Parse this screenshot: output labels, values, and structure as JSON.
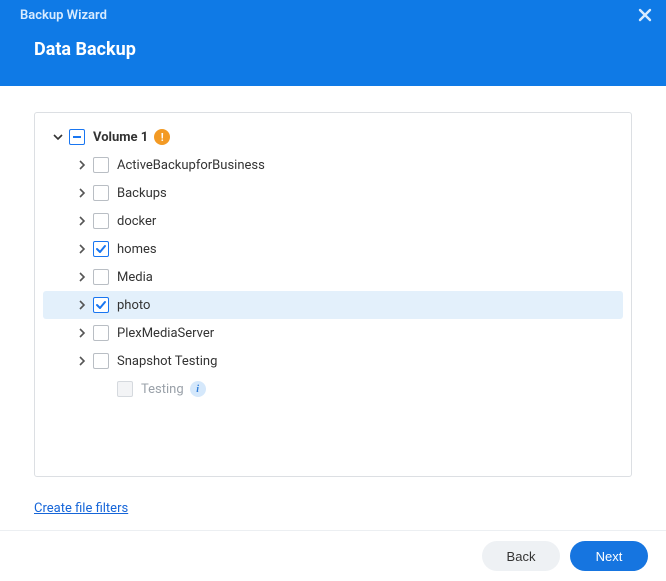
{
  "header": {
    "wizard_title": "Backup Wizard",
    "page_title": "Data Backup"
  },
  "tree": {
    "root": {
      "label": "Volume 1",
      "warn_badge": "!",
      "items": [
        {
          "label": "ActiveBackupforBusiness",
          "state": "unchecked",
          "expandable": true
        },
        {
          "label": "Backups",
          "state": "unchecked",
          "expandable": true
        },
        {
          "label": "docker",
          "state": "unchecked",
          "expandable": true
        },
        {
          "label": "homes",
          "state": "checked",
          "expandable": true
        },
        {
          "label": "Media",
          "state": "unchecked",
          "expandable": true
        },
        {
          "label": "photo",
          "state": "checked",
          "expandable": true,
          "selected": true
        },
        {
          "label": "PlexMediaServer",
          "state": "unchecked",
          "expandable": true
        },
        {
          "label": "Snapshot Testing",
          "state": "unchecked",
          "expandable": true
        },
        {
          "label": "Testing",
          "state": "disabled",
          "expandable": false,
          "info_badge": "i",
          "indent": 2
        }
      ]
    }
  },
  "links": {
    "filters": "Create file filters"
  },
  "footer": {
    "back": "Back",
    "next": "Next"
  }
}
